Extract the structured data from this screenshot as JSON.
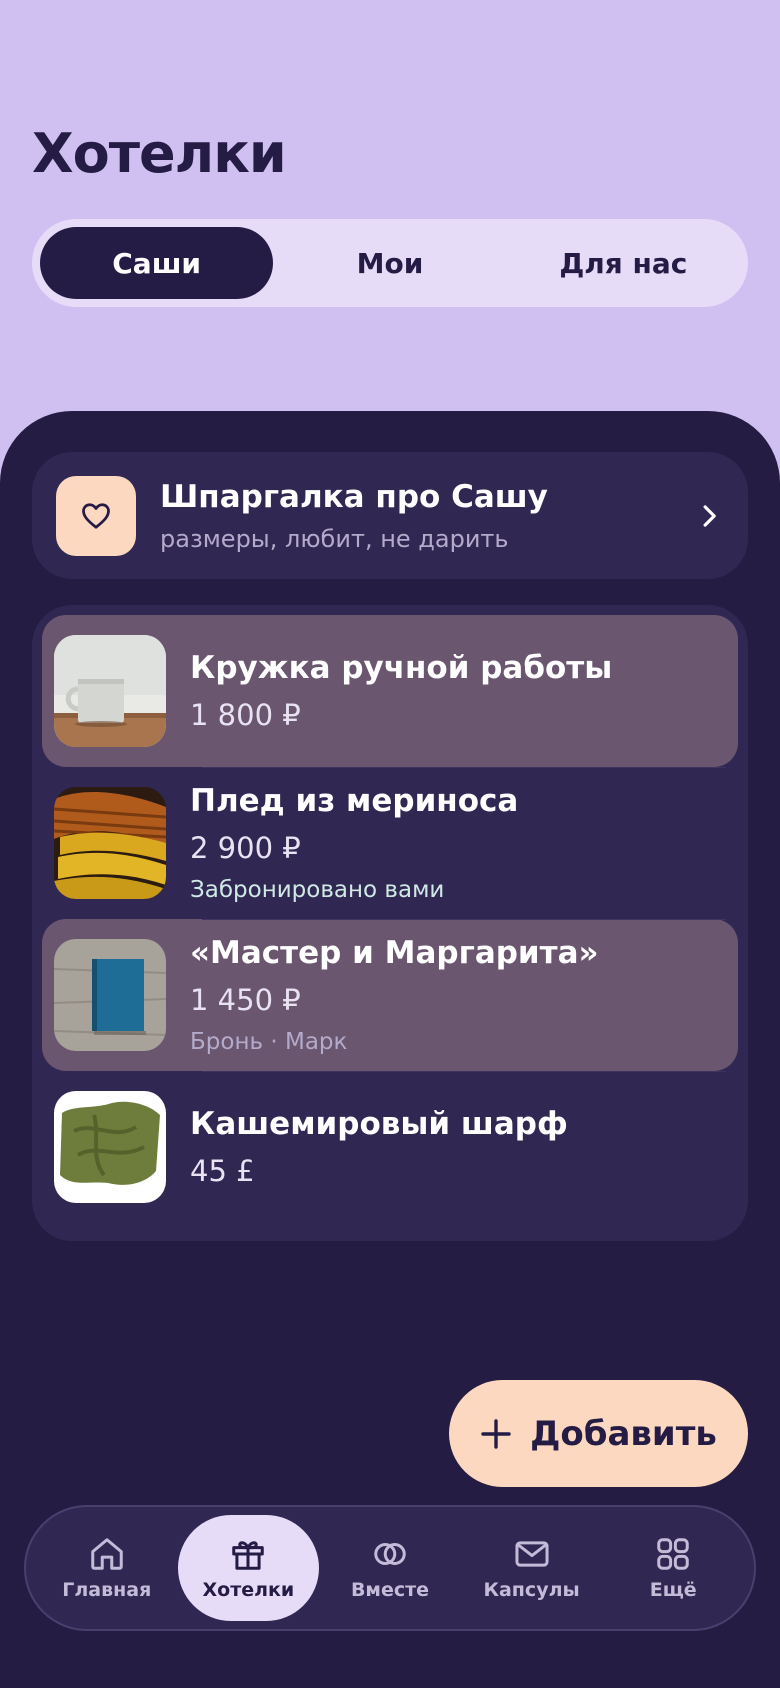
{
  "page": {
    "title": "Хотелки"
  },
  "segments": [
    {
      "label": "Саши",
      "active": true
    },
    {
      "label": "Мои",
      "active": false
    },
    {
      "label": "Для нас",
      "active": false
    }
  ],
  "cheatsheet": {
    "title": "Шпаргалка про Сашу",
    "subtitle": "размеры, любит, не дарить",
    "icon": "heart-icon"
  },
  "wishlist": [
    {
      "title": "Кружка ручной работы",
      "price": "1 800 ₽",
      "status": "",
      "image": "mug"
    },
    {
      "title": "Плед из мериноса",
      "price": "2 900 ₽",
      "status": "Забронировано вами",
      "image": "blanket"
    },
    {
      "title": "«Мастер и Маргарита»",
      "price": "1 450 ₽",
      "status": "Бронь · Марк",
      "image": "book"
    },
    {
      "title": "Кашемировый шарф",
      "price": "45 £",
      "status": "",
      "image": "scarf"
    }
  ],
  "fab": {
    "label": "Добавить",
    "icon": "plus-icon"
  },
  "tabbar": [
    {
      "label": "Главная",
      "icon": "home-icon",
      "active": false
    },
    {
      "label": "Хотелки",
      "icon": "gift-icon",
      "active": true
    },
    {
      "label": "Вместе",
      "icon": "rings-icon",
      "active": false
    },
    {
      "label": "Капсулы",
      "icon": "envelope-icon",
      "active": false
    },
    {
      "label": "Ещё",
      "icon": "grid-icon",
      "active": false
    }
  ],
  "colors": {
    "background": "#d0c0f2",
    "sheet": "#241c42",
    "card": "#302752",
    "highlight": "#6a566e",
    "accent": "#fdd8c0",
    "dark": "#251c45"
  }
}
